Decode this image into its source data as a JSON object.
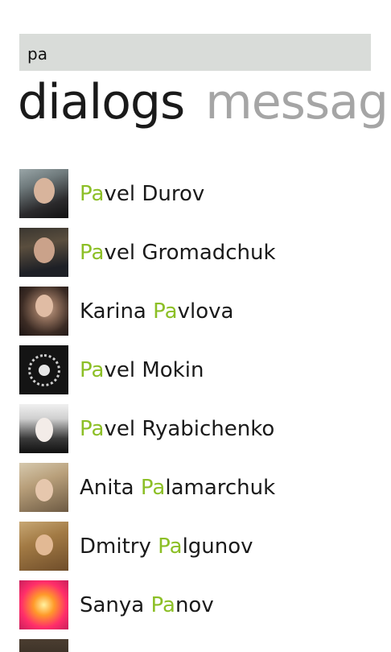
{
  "search": {
    "value": "pa",
    "placeholder": ""
  },
  "pivot": {
    "active": "dialogs",
    "inactive": "messag"
  },
  "colors": {
    "highlight": "#8cbf26",
    "search_bg": "#d9dcd9",
    "inactive_pivot": "#a5a5a5"
  },
  "contacts": [
    {
      "pre": "",
      "hl": "Pa",
      "post": "vel Durov"
    },
    {
      "pre": "",
      "hl": "Pa",
      "post": "vel Gromadchuk"
    },
    {
      "pre": "Karina ",
      "hl": "Pa",
      "post": "vlova"
    },
    {
      "pre": "",
      "hl": "Pa",
      "post": "vel Mokin"
    },
    {
      "pre": "",
      "hl": "Pa",
      "post": "vel Ryabichenko"
    },
    {
      "pre": "Anita ",
      "hl": "Pa",
      "post": "lamarchuk"
    },
    {
      "pre": "Dmitry ",
      "hl": "Pa",
      "post": "lgunov"
    },
    {
      "pre": "Sanya ",
      "hl": "Pa",
      "post": "nov"
    }
  ]
}
